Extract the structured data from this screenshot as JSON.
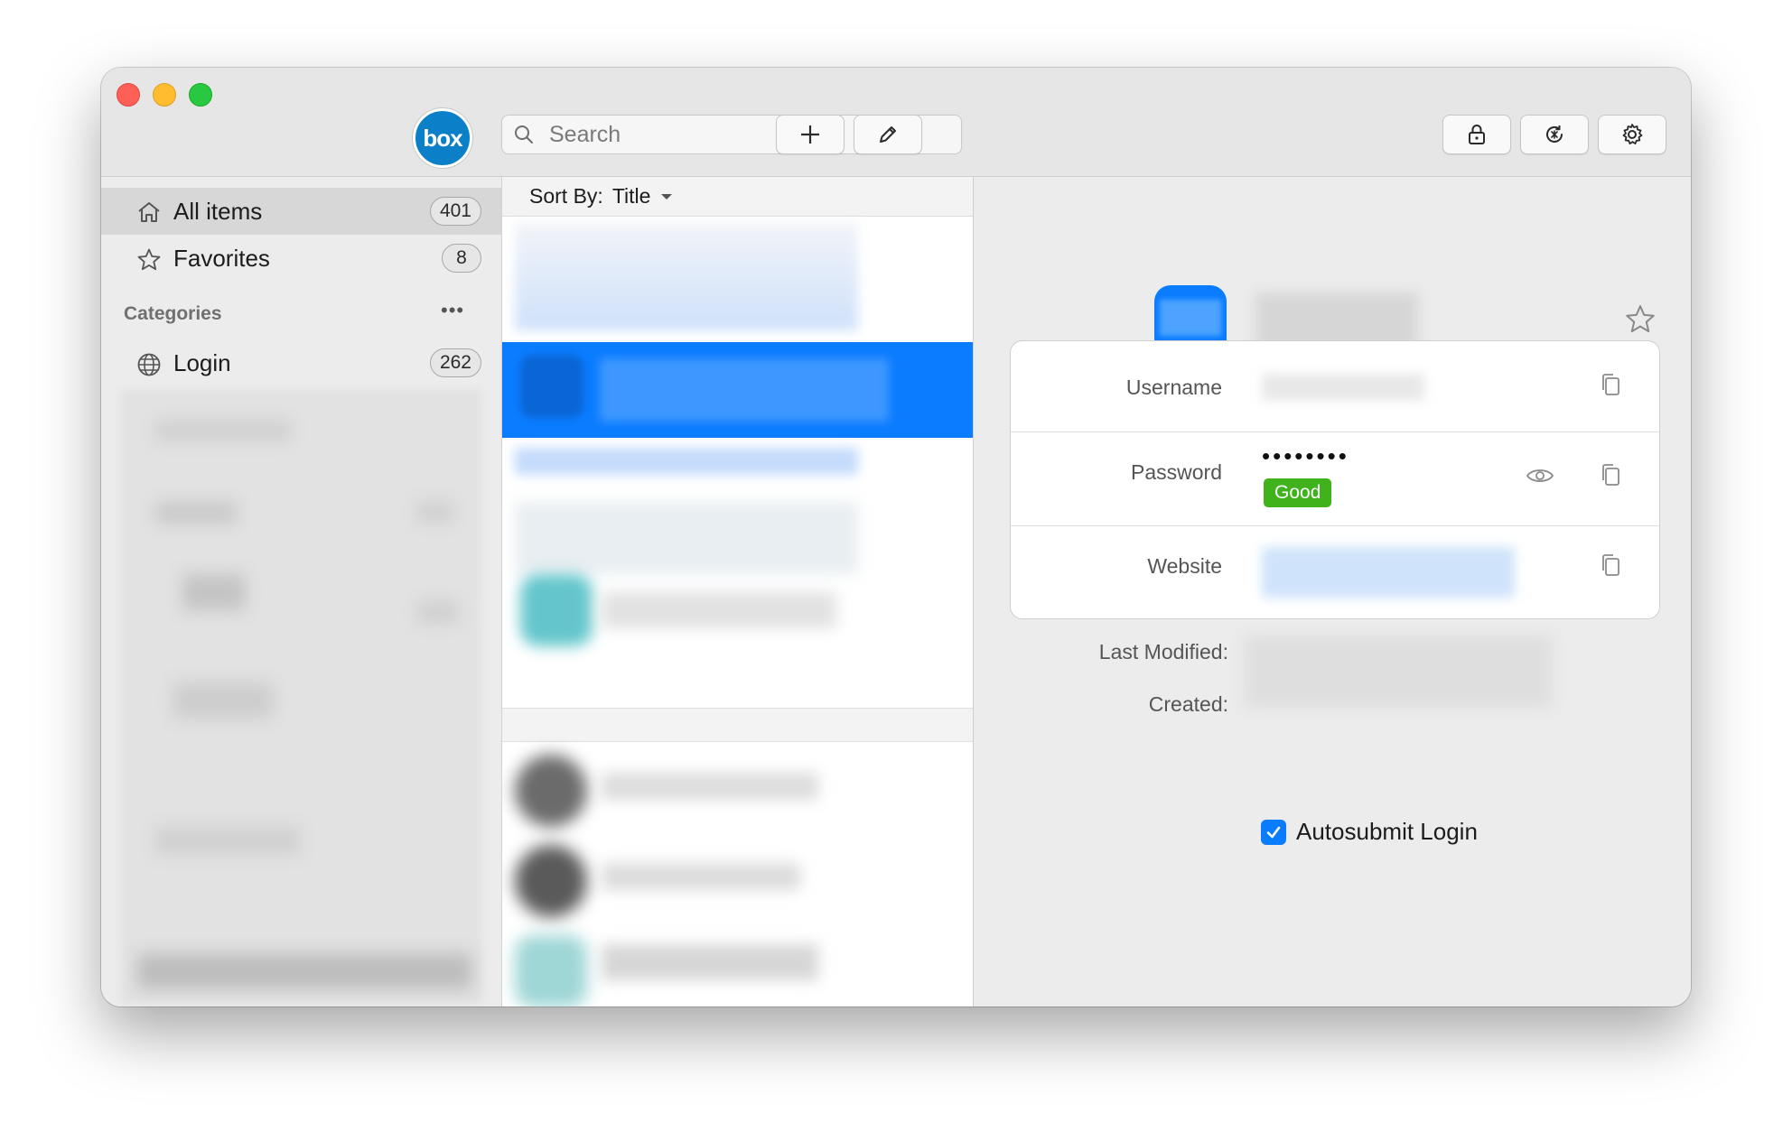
{
  "toolbar": {
    "logo_text": "box",
    "search_placeholder": "Search",
    "icons": [
      "add-icon",
      "edit-icon",
      "lock-icon",
      "sync-icon",
      "gear-icon"
    ]
  },
  "sidebar": {
    "items": [
      {
        "label": "All items",
        "count": "401",
        "icon": "home-icon"
      },
      {
        "label": "Favorites",
        "count": "8",
        "icon": "star-icon"
      }
    ],
    "categories_heading": "Categories",
    "categories_more": "•••",
    "categories": [
      {
        "label": "Login",
        "count": "262",
        "icon": "globe-icon"
      }
    ]
  },
  "list": {
    "sort_label": "Sort By:",
    "sort_value": "Title"
  },
  "detail": {
    "fields": [
      {
        "label": "Username",
        "value": ""
      },
      {
        "label": "Password",
        "value": "••••••••",
        "strength": "Good"
      },
      {
        "label": "Website",
        "value": ""
      }
    ],
    "last_modified_label": "Last Modified:",
    "created_label": "Created:",
    "autosubmit_label": "Autosubmit Login",
    "autosubmit_checked": true
  },
  "colors": {
    "accent": "#0a7cff",
    "selection": "#0a7cff",
    "strength_good": "#3fb21c"
  }
}
